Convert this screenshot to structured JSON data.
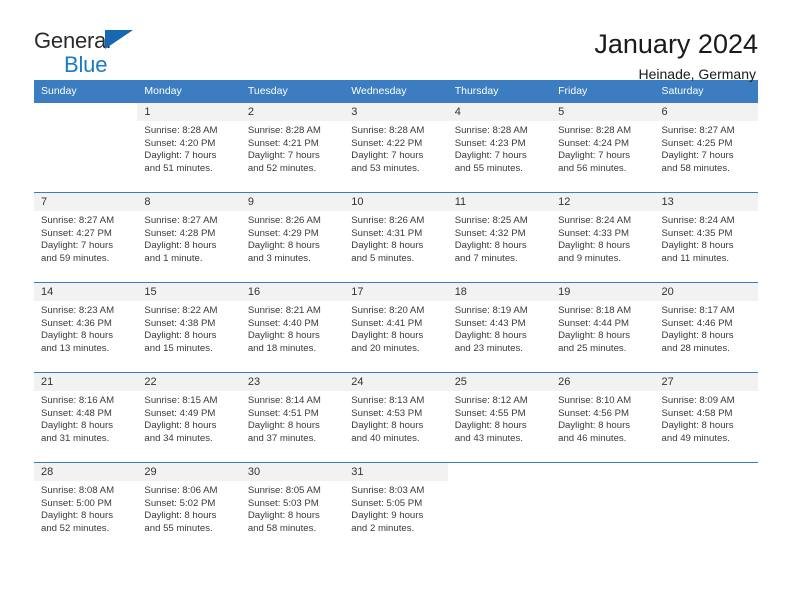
{
  "brand": {
    "name_top": "General",
    "name_bottom": "Blue",
    "triangle_icon": "triangle-icon",
    "accent_color": "#1b7ac4"
  },
  "header": {
    "title": "January 2024",
    "subtitle": "Heinade, Germany"
  },
  "calendar": {
    "header_bg": "#3b7dc0",
    "daynum_bg": "#f2f2f2",
    "weekday_headers": [
      "Sunday",
      "Monday",
      "Tuesday",
      "Wednesday",
      "Thursday",
      "Friday",
      "Saturday"
    ],
    "weeks": [
      [
        {
          "day": "",
          "sunrise": "",
          "sunset": "",
          "daylight1": "",
          "daylight2": ""
        },
        {
          "day": "1",
          "sunrise": "Sunrise: 8:28 AM",
          "sunset": "Sunset: 4:20 PM",
          "daylight1": "Daylight: 7 hours",
          "daylight2": "and 51 minutes."
        },
        {
          "day": "2",
          "sunrise": "Sunrise: 8:28 AM",
          "sunset": "Sunset: 4:21 PM",
          "daylight1": "Daylight: 7 hours",
          "daylight2": "and 52 minutes."
        },
        {
          "day": "3",
          "sunrise": "Sunrise: 8:28 AM",
          "sunset": "Sunset: 4:22 PM",
          "daylight1": "Daylight: 7 hours",
          "daylight2": "and 53 minutes."
        },
        {
          "day": "4",
          "sunrise": "Sunrise: 8:28 AM",
          "sunset": "Sunset: 4:23 PM",
          "daylight1": "Daylight: 7 hours",
          "daylight2": "and 55 minutes."
        },
        {
          "day": "5",
          "sunrise": "Sunrise: 8:28 AM",
          "sunset": "Sunset: 4:24 PM",
          "daylight1": "Daylight: 7 hours",
          "daylight2": "and 56 minutes."
        },
        {
          "day": "6",
          "sunrise": "Sunrise: 8:27 AM",
          "sunset": "Sunset: 4:25 PM",
          "daylight1": "Daylight: 7 hours",
          "daylight2": "and 58 minutes."
        }
      ],
      [
        {
          "day": "7",
          "sunrise": "Sunrise: 8:27 AM",
          "sunset": "Sunset: 4:27 PM",
          "daylight1": "Daylight: 7 hours",
          "daylight2": "and 59 minutes."
        },
        {
          "day": "8",
          "sunrise": "Sunrise: 8:27 AM",
          "sunset": "Sunset: 4:28 PM",
          "daylight1": "Daylight: 8 hours",
          "daylight2": "and 1 minute."
        },
        {
          "day": "9",
          "sunrise": "Sunrise: 8:26 AM",
          "sunset": "Sunset: 4:29 PM",
          "daylight1": "Daylight: 8 hours",
          "daylight2": "and 3 minutes."
        },
        {
          "day": "10",
          "sunrise": "Sunrise: 8:26 AM",
          "sunset": "Sunset: 4:31 PM",
          "daylight1": "Daylight: 8 hours",
          "daylight2": "and 5 minutes."
        },
        {
          "day": "11",
          "sunrise": "Sunrise: 8:25 AM",
          "sunset": "Sunset: 4:32 PM",
          "daylight1": "Daylight: 8 hours",
          "daylight2": "and 7 minutes."
        },
        {
          "day": "12",
          "sunrise": "Sunrise: 8:24 AM",
          "sunset": "Sunset: 4:33 PM",
          "daylight1": "Daylight: 8 hours",
          "daylight2": "and 9 minutes."
        },
        {
          "day": "13",
          "sunrise": "Sunrise: 8:24 AM",
          "sunset": "Sunset: 4:35 PM",
          "daylight1": "Daylight: 8 hours",
          "daylight2": "and 11 minutes."
        }
      ],
      [
        {
          "day": "14",
          "sunrise": "Sunrise: 8:23 AM",
          "sunset": "Sunset: 4:36 PM",
          "daylight1": "Daylight: 8 hours",
          "daylight2": "and 13 minutes."
        },
        {
          "day": "15",
          "sunrise": "Sunrise: 8:22 AM",
          "sunset": "Sunset: 4:38 PM",
          "daylight1": "Daylight: 8 hours",
          "daylight2": "and 15 minutes."
        },
        {
          "day": "16",
          "sunrise": "Sunrise: 8:21 AM",
          "sunset": "Sunset: 4:40 PM",
          "daylight1": "Daylight: 8 hours",
          "daylight2": "and 18 minutes."
        },
        {
          "day": "17",
          "sunrise": "Sunrise: 8:20 AM",
          "sunset": "Sunset: 4:41 PM",
          "daylight1": "Daylight: 8 hours",
          "daylight2": "and 20 minutes."
        },
        {
          "day": "18",
          "sunrise": "Sunrise: 8:19 AM",
          "sunset": "Sunset: 4:43 PM",
          "daylight1": "Daylight: 8 hours",
          "daylight2": "and 23 minutes."
        },
        {
          "day": "19",
          "sunrise": "Sunrise: 8:18 AM",
          "sunset": "Sunset: 4:44 PM",
          "daylight1": "Daylight: 8 hours",
          "daylight2": "and 25 minutes."
        },
        {
          "day": "20",
          "sunrise": "Sunrise: 8:17 AM",
          "sunset": "Sunset: 4:46 PM",
          "daylight1": "Daylight: 8 hours",
          "daylight2": "and 28 minutes."
        }
      ],
      [
        {
          "day": "21",
          "sunrise": "Sunrise: 8:16 AM",
          "sunset": "Sunset: 4:48 PM",
          "daylight1": "Daylight: 8 hours",
          "daylight2": "and 31 minutes."
        },
        {
          "day": "22",
          "sunrise": "Sunrise: 8:15 AM",
          "sunset": "Sunset: 4:49 PM",
          "daylight1": "Daylight: 8 hours",
          "daylight2": "and 34 minutes."
        },
        {
          "day": "23",
          "sunrise": "Sunrise: 8:14 AM",
          "sunset": "Sunset: 4:51 PM",
          "daylight1": "Daylight: 8 hours",
          "daylight2": "and 37 minutes."
        },
        {
          "day": "24",
          "sunrise": "Sunrise: 8:13 AM",
          "sunset": "Sunset: 4:53 PM",
          "daylight1": "Daylight: 8 hours",
          "daylight2": "and 40 minutes."
        },
        {
          "day": "25",
          "sunrise": "Sunrise: 8:12 AM",
          "sunset": "Sunset: 4:55 PM",
          "daylight1": "Daylight: 8 hours",
          "daylight2": "and 43 minutes."
        },
        {
          "day": "26",
          "sunrise": "Sunrise: 8:10 AM",
          "sunset": "Sunset: 4:56 PM",
          "daylight1": "Daylight: 8 hours",
          "daylight2": "and 46 minutes."
        },
        {
          "day": "27",
          "sunrise": "Sunrise: 8:09 AM",
          "sunset": "Sunset: 4:58 PM",
          "daylight1": "Daylight: 8 hours",
          "daylight2": "and 49 minutes."
        }
      ],
      [
        {
          "day": "28",
          "sunrise": "Sunrise: 8:08 AM",
          "sunset": "Sunset: 5:00 PM",
          "daylight1": "Daylight: 8 hours",
          "daylight2": "and 52 minutes."
        },
        {
          "day": "29",
          "sunrise": "Sunrise: 8:06 AM",
          "sunset": "Sunset: 5:02 PM",
          "daylight1": "Daylight: 8 hours",
          "daylight2": "and 55 minutes."
        },
        {
          "day": "30",
          "sunrise": "Sunrise: 8:05 AM",
          "sunset": "Sunset: 5:03 PM",
          "daylight1": "Daylight: 8 hours",
          "daylight2": "and 58 minutes."
        },
        {
          "day": "31",
          "sunrise": "Sunrise: 8:03 AM",
          "sunset": "Sunset: 5:05 PM",
          "daylight1": "Daylight: 9 hours",
          "daylight2": "and 2 minutes."
        },
        {
          "day": "",
          "sunrise": "",
          "sunset": "",
          "daylight1": "",
          "daylight2": ""
        },
        {
          "day": "",
          "sunrise": "",
          "sunset": "",
          "daylight1": "",
          "daylight2": ""
        },
        {
          "day": "",
          "sunrise": "",
          "sunset": "",
          "daylight1": "",
          "daylight2": ""
        }
      ]
    ]
  }
}
